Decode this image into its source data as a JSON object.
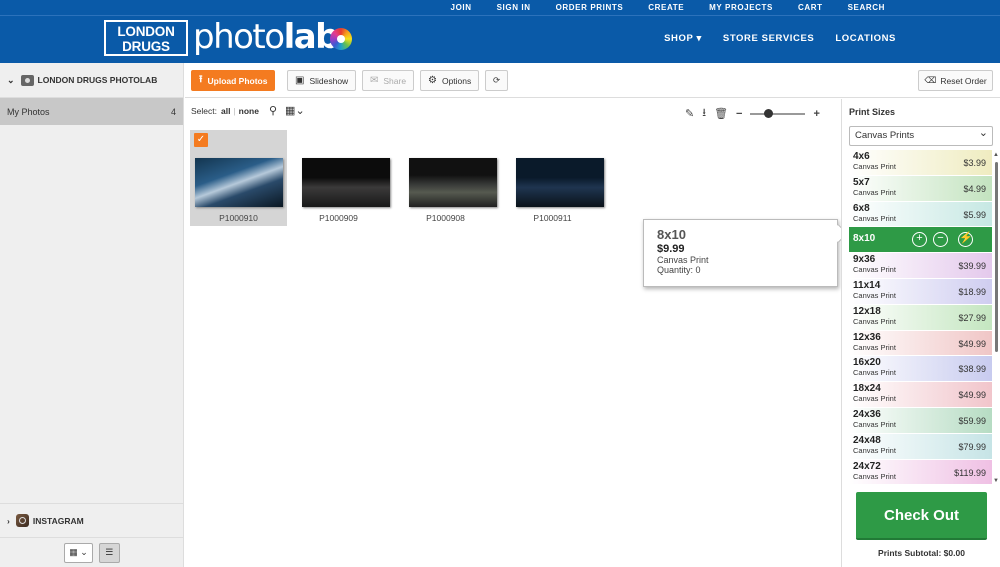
{
  "topnav": [
    "JOIN",
    "SIGN IN",
    "ORDER PRINTS",
    "CREATE",
    "MY PROJECTS",
    "CART",
    "SEARCH"
  ],
  "brand": {
    "box_line1": "LONDON",
    "box_line2": "DRUGS",
    "photo": "photo",
    "lab": "lab"
  },
  "mainnav": [
    "SHOP ▾",
    "STORE SERVICES",
    "LOCATIONS"
  ],
  "left": {
    "source": "LONDON DRUGS PHOTOLAB",
    "album": "My Photos",
    "album_count": "4",
    "instagram": "INSTAGRAM"
  },
  "toolbar": {
    "upload": "Upload Photos",
    "slideshow": "Slideshow",
    "share": "Share",
    "options": "Options",
    "reset": "Reset Order"
  },
  "select": {
    "label": "Select:",
    "all": "all",
    "none": "none"
  },
  "photos": [
    {
      "name": "P1000910",
      "selected": true
    },
    {
      "name": "P1000909",
      "selected": false
    },
    {
      "name": "P1000908",
      "selected": false
    },
    {
      "name": "P1000911",
      "selected": false
    }
  ],
  "tooltip": {
    "size": "8x10",
    "price": "$9.99",
    "type": "Canvas Print",
    "quantity": "Quantity: 0"
  },
  "right": {
    "title": "Print Sizes",
    "dropdown": "Canvas Prints",
    "checkout": "Check Out",
    "subtotal": "Prints Subtotal: $0.00"
  },
  "sizes": [
    {
      "size": "4x6",
      "type": "Canvas Print",
      "price": "$3.99",
      "color": "#efecc0"
    },
    {
      "size": "5x7",
      "type": "Canvas Print",
      "price": "$4.99",
      "color": "#c3e3bf"
    },
    {
      "size": "6x8",
      "type": "Canvas Print",
      "price": "$5.99",
      "color": "#c6e8e3"
    },
    {
      "size": "8x10",
      "type": "Canvas Print",
      "price": "$9.99",
      "color": "#2e9a46",
      "active": true
    },
    {
      "size": "9x36",
      "type": "Canvas Print",
      "price": "$39.99",
      "color": "#e4c9ec"
    },
    {
      "size": "11x14",
      "type": "Canvas Print",
      "price": "$18.99",
      "color": "#cfcdf0"
    },
    {
      "size": "12x18",
      "type": "Canvas Print",
      "price": "$27.99",
      "color": "#c4e6c0"
    },
    {
      "size": "12x36",
      "type": "Canvas Print",
      "price": "$49.99",
      "color": "#f0c6c6"
    },
    {
      "size": "16x20",
      "type": "Canvas Print",
      "price": "$38.99",
      "color": "#c8cbef"
    },
    {
      "size": "18x24",
      "type": "Canvas Print",
      "price": "$49.99",
      "color": "#f1c5cb"
    },
    {
      "size": "24x36",
      "type": "Canvas Print",
      "price": "$59.99",
      "color": "#b6dcc3"
    },
    {
      "size": "24x48",
      "type": "Canvas Print",
      "price": "$79.99",
      "color": "#c6e4e6"
    },
    {
      "size": "24x72",
      "type": "Canvas Print",
      "price": "$119.99",
      "color": "#efc0e4"
    }
  ]
}
